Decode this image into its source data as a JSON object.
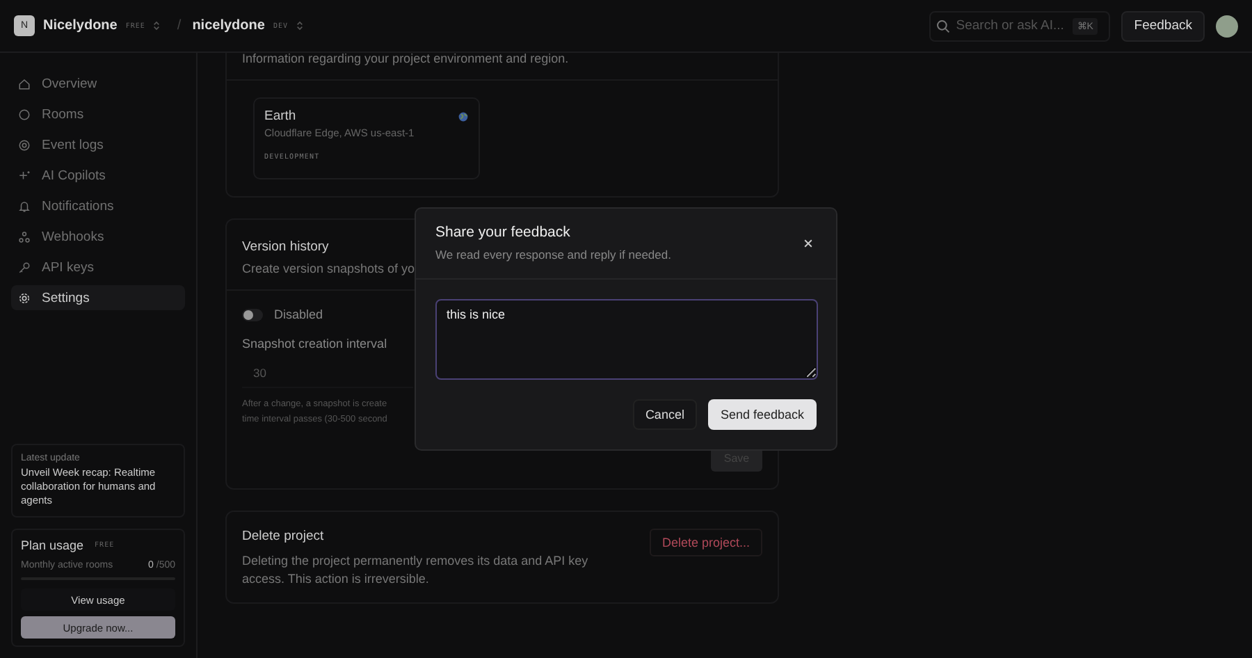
{
  "header": {
    "org": {
      "initial": "N",
      "name": "Nicelydone",
      "badge": "FREE"
    },
    "separator": "/",
    "project": {
      "name": "nicelydone",
      "badge": "DEV"
    },
    "search": {
      "placeholder": "Search or ask AI...",
      "shortcut": "⌘K"
    },
    "feedback_button": "Feedback"
  },
  "sidebar": {
    "items": [
      {
        "label": "Overview",
        "selected": false
      },
      {
        "label": "Rooms",
        "selected": false
      },
      {
        "label": "Event logs",
        "selected": false
      },
      {
        "label": "AI Copilots",
        "selected": false
      },
      {
        "label": "Notifications",
        "selected": false
      },
      {
        "label": "Webhooks",
        "selected": false
      },
      {
        "label": "API keys",
        "selected": false
      },
      {
        "label": "Settings",
        "selected": true
      }
    ],
    "update": {
      "label": "Latest update",
      "title": "Unveil Week recap: Realtime collaboration for humans and agents"
    },
    "plan": {
      "title": "Plan usage",
      "badge": "FREE",
      "metric": "Monthly active rooms",
      "used": "0",
      "limit": "/500",
      "level": 0,
      "view_button": "View usage",
      "upgrade_button": "Upgrade now..."
    }
  },
  "environment": {
    "description": "Information regarding your project environment and region.",
    "region": {
      "name": "Earth",
      "detail": "Cloudflare Edge, AWS us-east-1",
      "tag": "DEVELOPMENT"
    }
  },
  "version_history": {
    "title": "Version history",
    "description": "Create version snapshots of yo",
    "toggle": {
      "label": "Disabled",
      "on": false
    },
    "interval": {
      "label": "Snapshot creation interval",
      "value": "30",
      "hint_lines": [
        "After a change, a snapshot is create",
        "time interval passes (30-500 second"
      ]
    },
    "save_button": "Save"
  },
  "delete_project": {
    "title": "Delete project",
    "description": "Deleting the project permanently removes its data and API key access. This action is irreversible.",
    "button": "Delete project..."
  },
  "dialog": {
    "title": "Share your feedback",
    "subtitle": "We read every response and reply if needed.",
    "value": "this is nice",
    "cancel_button": "Cancel",
    "send_button": "Send feedback"
  }
}
